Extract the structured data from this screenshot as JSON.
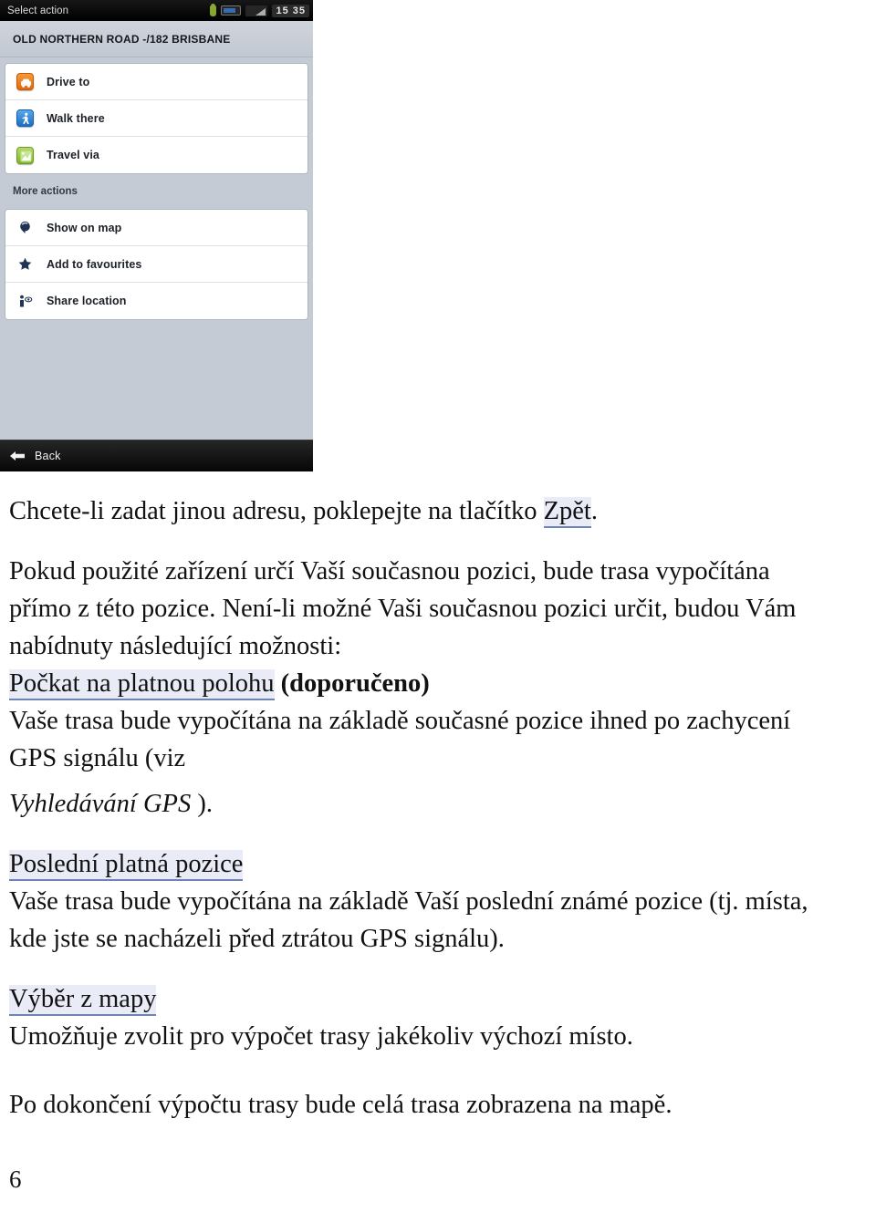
{
  "screenshot": {
    "statusbar": {
      "title": "Select action",
      "time": "15 35",
      "icons": [
        "android-icon",
        "battery-icon",
        "signal-icon"
      ]
    },
    "address": "OLD NORTHERN ROAD -/182  BRISBANE",
    "primary_actions": [
      {
        "label": "Drive to",
        "icon": "car-icon",
        "color": "#e2690f"
      },
      {
        "label": "Walk there",
        "icon": "pedestrian-icon",
        "color": "#1a6fc4"
      },
      {
        "label": "Travel via",
        "icon": "route-icon",
        "color": "#82b52e"
      }
    ],
    "more_actions_header": "More actions",
    "more_actions": [
      {
        "label": "Show on map",
        "icon": "map-pin-icon",
        "color": "#1f3455"
      },
      {
        "label": "Add to favourites",
        "icon": "star-icon",
        "color": "#1f3455"
      },
      {
        "label": "Share location",
        "icon": "share-location-icon",
        "color": "#1f3455"
      }
    ],
    "back_label": "Back",
    "back_icon": "arrow-left-icon"
  },
  "document": {
    "para1": "Chcete-li zadat jinou adresu, poklepejte na tlačítko ",
    "para1_link": "Zpět",
    "para1_end": ".",
    "para2_line1": "Pokud použité zařízení určí Vaší současnou pozici, bude trasa vypočítána",
    "para2_line2": "přímo z této pozice. Není-li možné Vaši současnou pozici určit, budou Vám",
    "para2_line3": "nabídnuty následující možnosti:",
    "option1_heading": "Počkat na platnou polohu",
    "option1_bold": " (doporučeno)",
    "option1_line1": "Vaše trasa bude vypočítána na základě současné pozice ihned po zachycení",
    "option1_line2": "GPS signálu (viz",
    "option1_ref_italic": "Vyhledávání GPS",
    "option1_ref_end": " ).",
    "option2_heading": "Poslední platná pozice",
    "option2_line1": "Vaše trasa bude vypočítána na základě Vaší poslední známé pozice (tj. místa,",
    "option2_line2": "kde jste se nacházeli před ztrátou GPS signálu).",
    "option3_heading": "Výběr z mapy",
    "option3_line1": "Umožňuje zvolit pro výpočet trasy jakékoliv výchozí místo.",
    "closing": "Po dokončení výpočtu trasy bude celá trasa zobrazena na mapě.",
    "page_number": "6"
  },
  "colors": {
    "link_highlight": "#e9ecf6",
    "link_underline": "#6d84b4",
    "phone_background": "#c5cbd4",
    "statusbar": "#000000"
  }
}
